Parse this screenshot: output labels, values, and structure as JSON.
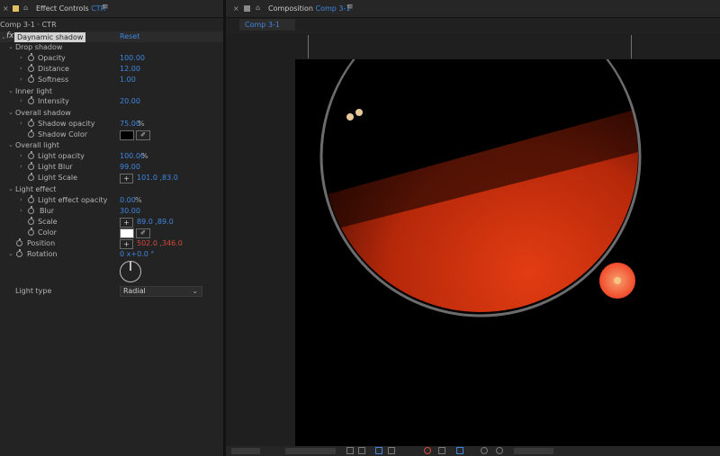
{
  "left_panel": {
    "title": "Effect Controls",
    "title_accent": "CTR",
    "close": "×",
    "menu": "≡",
    "layer_path": "Comp 3-1 · CTR",
    "effect": {
      "fx": "fx",
      "name": "Daynamic shadow",
      "reset": "Reset"
    },
    "groups": {
      "drop_shadow": "Drop shadow",
      "inner_light": "Inner light",
      "overall_shadow": "Overall shadow",
      "overall_light": "Overall light",
      "light_effect": "Light effect"
    },
    "props": {
      "opacity": {
        "label": "Opacity",
        "value": "100.00"
      },
      "distance": {
        "label": "Distance",
        "value": "12.00"
      },
      "softness": {
        "label": "Softness",
        "value": "1.00"
      },
      "intensity": {
        "label": "Intensity",
        "value": "20.00"
      },
      "shadow_opacity": {
        "label": "Shadow opacity",
        "value": "75.00",
        "unit": "%"
      },
      "shadow_color": {
        "label": "Shadow Color",
        "color": "#000000"
      },
      "light_opacity": {
        "label": "Light opacity",
        "value": "100.00",
        "unit": "%"
      },
      "light_blur": {
        "label": "Light Blur",
        "value": "99.00"
      },
      "light_scale": {
        "label": "Light Scale",
        "value": "101.0 ,83.0"
      },
      "light_effect_opacity": {
        "label": "Light effect opacity",
        "value": "0.00",
        "unit": "%"
      },
      "blur": {
        "label": "Blur",
        "value": "30.00"
      },
      "scale": {
        "label": "Scale",
        "value": "89.0 ,89.0"
      },
      "color": {
        "label": "Color",
        "color": "#ffffff"
      },
      "position": {
        "label": "Position",
        "value": "502.0 ,346.0"
      },
      "rotation": {
        "label": "Rotation",
        "value": "0 x+0.0 °"
      },
      "light_type": {
        "label": "Light type",
        "value": "Radial"
      }
    }
  },
  "right_panel": {
    "title": "Composition",
    "title_accent": "Comp 3-1",
    "close": "×",
    "menu": "≡",
    "tab": "Comp 3-1"
  },
  "colors": {
    "accent_blue": "#3f86e0",
    "position_red": "#d64a3a",
    "canvas_bg": "#000000"
  }
}
